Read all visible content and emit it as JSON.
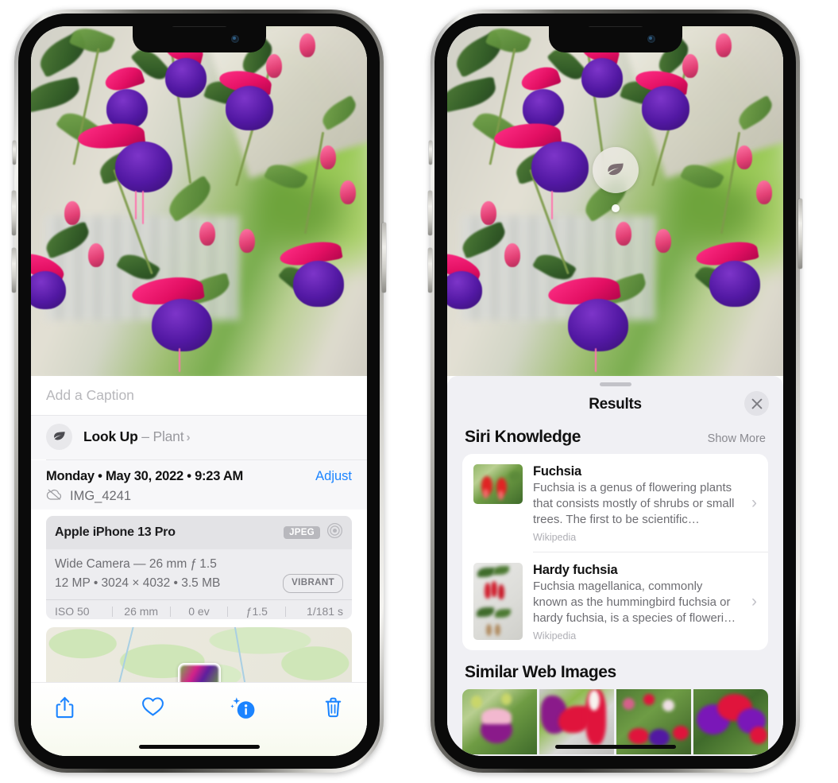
{
  "left_phone": {
    "photo": {
      "alt_name": "fuchsia-flowers-photo"
    },
    "caption_field": {
      "placeholder": "Add a Caption",
      "value": ""
    },
    "lookup_row": {
      "icon": "leaf-icon",
      "label": "Look Up",
      "dash": "–",
      "subject": "Plant",
      "chevron": "›"
    },
    "metadata": {
      "date_line": "Monday • May 30, 2022 • 9:23 AM",
      "adjust_label": "Adjust",
      "cloud_icon": "cloud-slash-icon",
      "filename": "IMG_4241"
    },
    "camera_card": {
      "device": "Apple iPhone 13 Pro",
      "format_badge": "JPEG",
      "lens_icon": "aperture-icon",
      "lens_line": "Wide Camera — 26 mm ƒ 1.5",
      "size_line": "12 MP • 3024 × 4032 • 3.5 MB",
      "vibrant_badge": "VIBRANT",
      "exif": [
        "ISO 50",
        "26 mm",
        "0 ev",
        "ƒ1.5",
        "1/181 s"
      ]
    },
    "map": {
      "name": "location-map",
      "pin": "photo-thumbnail-pin"
    },
    "toolbar": [
      {
        "name": "share-button",
        "icon": "share-icon"
      },
      {
        "name": "favorite-button",
        "icon": "heart-icon"
      },
      {
        "name": "info-button",
        "icon": "info-sparkle-icon"
      },
      {
        "name": "delete-button",
        "icon": "trash-icon"
      }
    ],
    "accent_color": "#1b84ff"
  },
  "right_phone": {
    "photo": {
      "alt_name": "fuchsia-flowers-photo"
    },
    "leaf_badge": {
      "icon": "leaf-icon",
      "name": "visual-lookup-leaf-badge"
    },
    "sheet": {
      "grabber": "drag-handle",
      "title": "Results",
      "close_icon": "close-icon"
    },
    "siri_knowledge": {
      "heading": "Siri Knowledge",
      "show_more": "Show More",
      "items": [
        {
          "title": "Fuchsia",
          "description": "Fuchsia is a genus of flowering plants that consists mostly of shrubs or small trees. The first to be scientific…",
          "source": "Wikipedia",
          "chevron": "›"
        },
        {
          "title": "Hardy fuchsia",
          "description": "Fuchsia magellanica, commonly known as the hummingbird fuchsia or hardy fuchsia, is a species of floweri…",
          "source": "Wikipedia",
          "chevron": "›"
        }
      ]
    },
    "similar_web_images": {
      "heading": "Similar Web Images",
      "thumbnails": [
        "fuchsia-thumbnail-1",
        "fuchsia-thumbnail-2",
        "fuchsia-thumbnail-3",
        "fuchsia-thumbnail-4"
      ]
    }
  }
}
